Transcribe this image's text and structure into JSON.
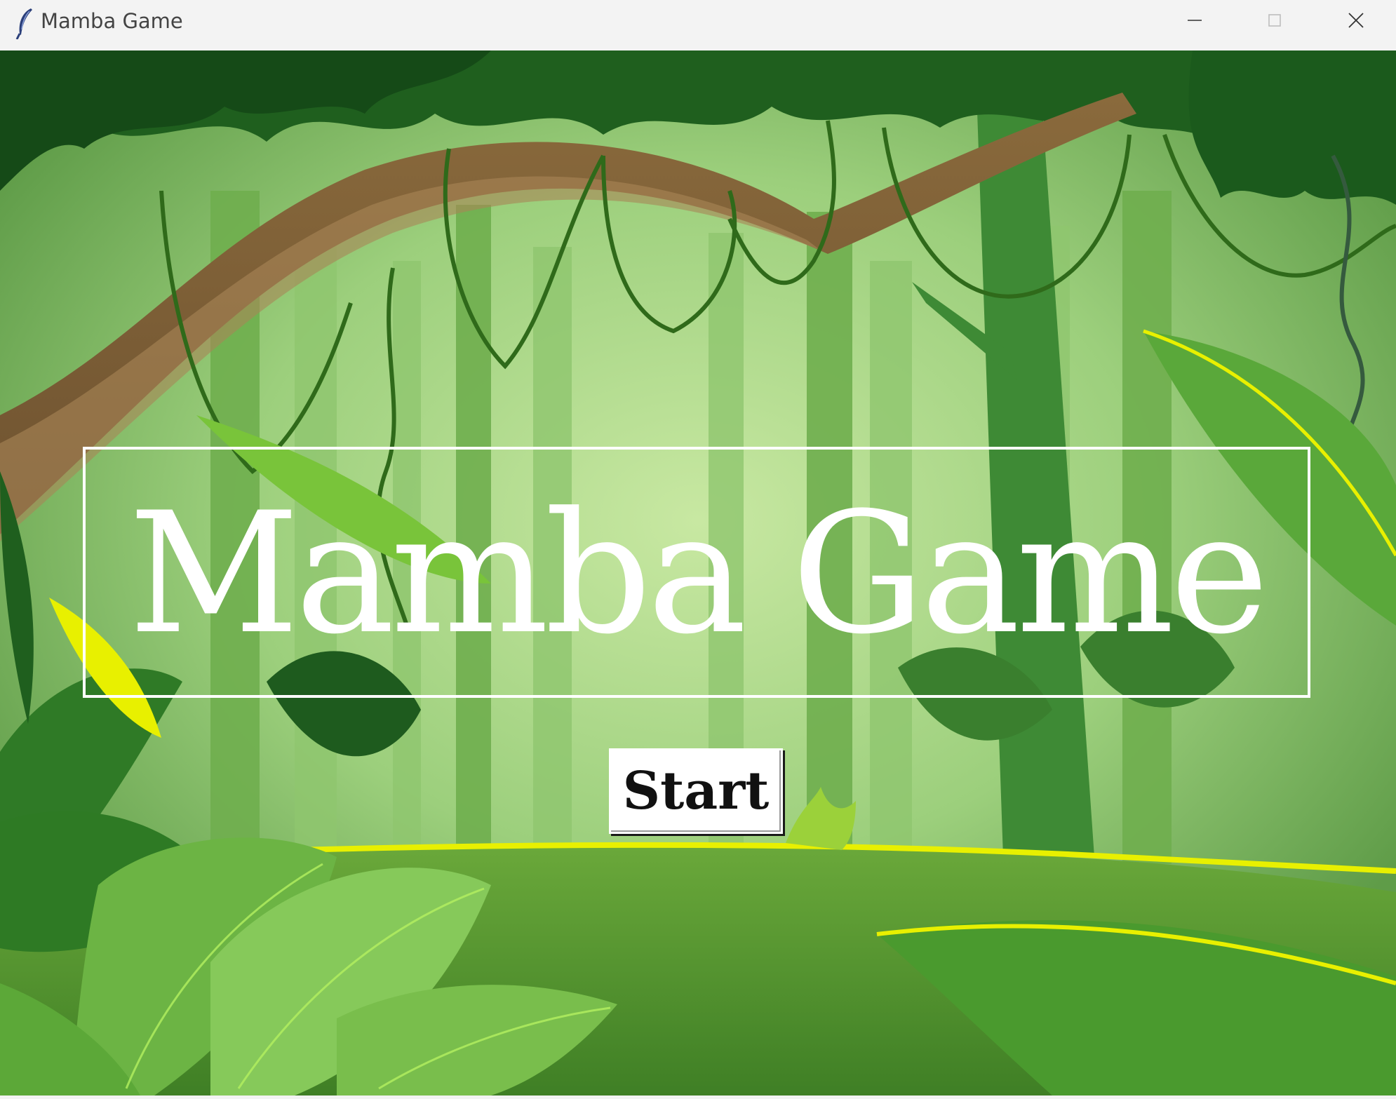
{
  "window": {
    "title": "Mamba Game",
    "icon": "feather-icon",
    "controls": [
      "minimize-icon",
      "maximize-icon",
      "close-icon"
    ]
  },
  "game": {
    "title": "Mamba Game",
    "start_label": "Start",
    "background": "jungle-scene"
  },
  "colors": {
    "title_text": "#ffffff",
    "button_bg": "#ffffff",
    "button_text": "#111111",
    "titlebar_bg": "#f3f3f3"
  }
}
